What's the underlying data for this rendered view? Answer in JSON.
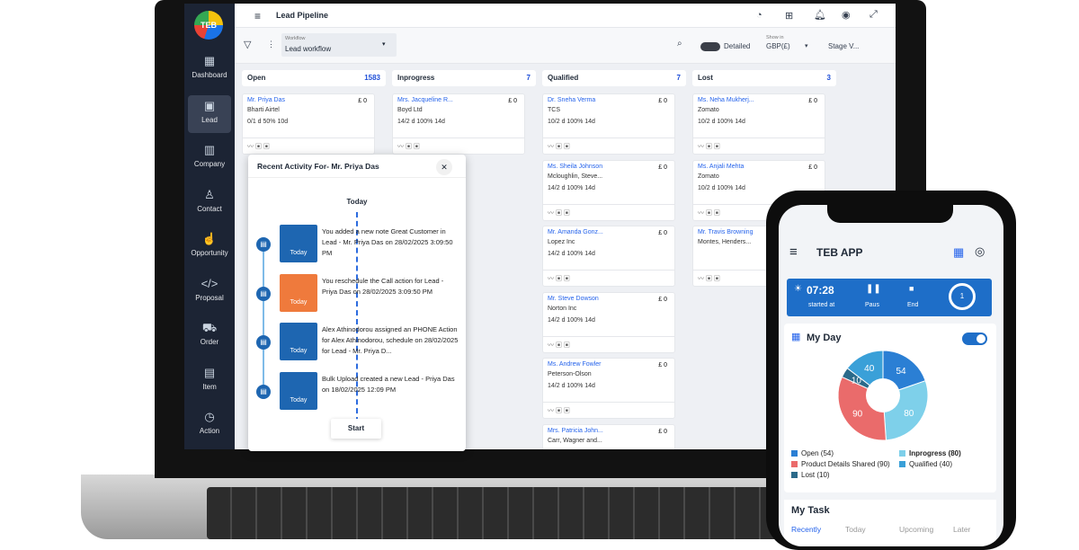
{
  "app": {
    "title": "Lead Pipeline",
    "logo_text": "TEB"
  },
  "sidebar": {
    "items": [
      {
        "label": "Dashboard",
        "icon": "grid-icon",
        "glyph": "▦"
      },
      {
        "label": "Lead",
        "icon": "briefcase-icon",
        "glyph": "▣"
      },
      {
        "label": "Company",
        "icon": "building-icon",
        "glyph": "▥"
      },
      {
        "label": "Contact",
        "icon": "person-icon",
        "glyph": "♙"
      },
      {
        "label": "Opportunity",
        "icon": "thumbs-up-icon",
        "glyph": "☝"
      },
      {
        "label": "Proposal",
        "icon": "code-icon",
        "glyph": "</>"
      },
      {
        "label": "Order",
        "icon": "cart-icon",
        "glyph": "⛟"
      },
      {
        "label": "Item",
        "icon": "box-icon",
        "glyph": "▤"
      },
      {
        "label": "Action",
        "icon": "clock-icon",
        "glyph": "◷"
      }
    ]
  },
  "toolbar": {
    "workflow_label": "Workflow",
    "workflow_value": "Lead workflow",
    "detailed_label": "Detailed",
    "show_in_label": "Show in",
    "currency": "GBP(£)",
    "stage_view": "Stage V..."
  },
  "columns": [
    {
      "title": "Open",
      "count": "1583",
      "cards": [
        {
          "name": "Mr. Priya Das",
          "amount": "£ 0",
          "company": "Bharti Airtel",
          "stats": "0/1 d   50%   10d"
        }
      ]
    },
    {
      "title": "Inprogress",
      "count": "7",
      "cards": [
        {
          "name": "Mrs. Jacqueline R...",
          "amount": "£ 0",
          "company": "Boyd Ltd",
          "stats": "14/2 d   100%   14d"
        }
      ]
    },
    {
      "title": "Qualified",
      "count": "7",
      "cards": [
        {
          "name": "Dr. Sneha Verma",
          "amount": "£ 0",
          "company": "TCS",
          "stats": "10/2 d   100%   14d"
        },
        {
          "name": "Ms. Sheila Johnson",
          "amount": "£ 0",
          "company": "Mcloughlin, Steve...",
          "stats": "14/2 d   100%   14d"
        },
        {
          "name": "Mr. Amanda Gonz...",
          "amount": "£ 0",
          "company": "Lopez Inc",
          "stats": "14/2 d   100%   14d"
        },
        {
          "name": "Mr. Steve Dowson",
          "amount": "£ 0",
          "company": "Norton Inc",
          "stats": "14/2 d   100%   14d"
        },
        {
          "name": "Ms. Andrew Fowler",
          "amount": "£ 0",
          "company": "Peterson-Olson",
          "stats": "14/2 d   100%   14d"
        },
        {
          "name": "Mrs. Patricia John...",
          "amount": "£ 0",
          "company": "Carr, Wagner and...",
          "stats": ""
        }
      ]
    },
    {
      "title": "Lost",
      "count": "3",
      "cards": [
        {
          "name": "Ms. Neha Mukherj...",
          "amount": "£ 0",
          "company": "Zomato",
          "stats": "10/2 d   100%   14d"
        },
        {
          "name": "Ms. Anjali Mehta",
          "amount": "£ 0",
          "company": "Zomato",
          "stats": "10/2 d   100%   14d"
        },
        {
          "name": "Mr. Travis Browning",
          "amount": "£ 0",
          "company": "Montes, Henders...",
          "stats": ""
        }
      ]
    }
  ],
  "popup": {
    "title": "Recent Activity For- Mr. Priya Das",
    "today": "Today",
    "start": "Start",
    "events": [
      {
        "text": "You added a new note Great Customer in Lead - Mr. Priya Das on 28/02/2025 3:09:50 PM",
        "thumb": "Today",
        "color": "#1e66b1"
      },
      {
        "text": "You reschedule the Call action for Lead - Priya Das on 28/02/2025 3:09:50 PM",
        "thumb": "Today",
        "color": "#ef7a3c"
      },
      {
        "text": "Alex Athinodorou assigned an PHONE Action for Alex Athinodorou, schedule on 28/02/2025 for Lead - Mr. Priya D...",
        "thumb": "Today",
        "color": "#1e66b1"
      },
      {
        "text": "Bulk Upload created a new Lead - Priya Das on 18/02/2025 12:09 PM",
        "thumb": "Today",
        "color": "#1e66b1"
      }
    ]
  },
  "phone": {
    "app_title": "TEB APP",
    "time": "07:28",
    "started_at": "started at",
    "pause": "Paus",
    "end": "End",
    "timer_count": "1",
    "my_day": "My Day",
    "my_task": "My Task",
    "tabs": [
      "Recently",
      "Today",
      "Upcoming",
      "Later"
    ],
    "legend": [
      {
        "label": "Open (54)",
        "color": "#2b7fd4"
      },
      {
        "label": "Inprogress (80)",
        "color": "#7ed0ea"
      },
      {
        "label": "Product Details Shared (90)",
        "color": "#ea6b6b"
      },
      {
        "label": "Qualified (40)",
        "color": "#3aa0d8"
      },
      {
        "label": "Lost (10)",
        "color": "#2b6a8a"
      }
    ]
  },
  "chart_data": {
    "type": "pie",
    "categories": [
      "Open",
      "Inprogress",
      "Product Details Shared",
      "Qualified",
      "Lost"
    ],
    "values": [
      54,
      80,
      90,
      40,
      10
    ],
    "colors": [
      "#2b7fd4",
      "#7ed0ea",
      "#ea6b6b",
      "#3aa0d8",
      "#2b6a8a"
    ]
  }
}
